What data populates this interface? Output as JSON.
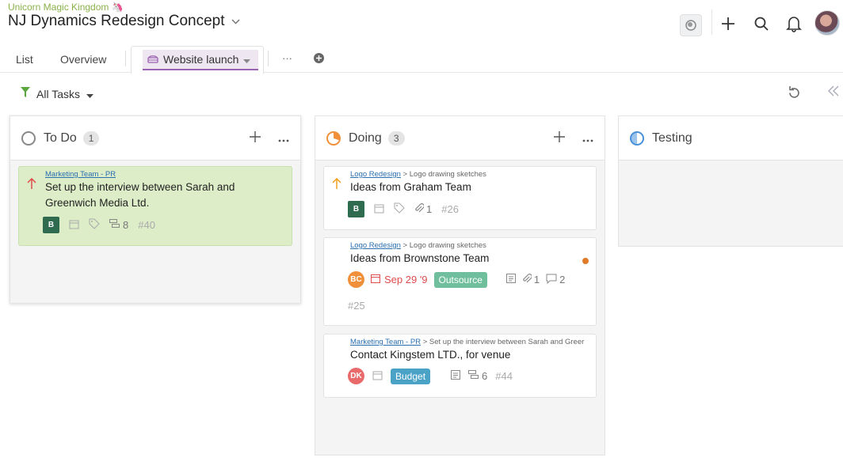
{
  "header": {
    "workspace": "Unicorn Magic Kingdom 🦄",
    "project_title": "NJ Dynamics Redesign Concept"
  },
  "tabs": {
    "list": "List",
    "overview": "Overview",
    "active": "Website launch",
    "more": "···"
  },
  "filter": {
    "label": "All Tasks"
  },
  "columns": {
    "todo": {
      "title": "To Do",
      "count": "1"
    },
    "doing": {
      "title": "Doing",
      "count": "3"
    },
    "testing": {
      "title": "Testing"
    }
  },
  "cards": {
    "c40": {
      "parent": "Marketing Team - PR",
      "title": "Set up the interview between Sarah and Greenwich Media Ltd.",
      "avatar": "B",
      "subtasks": "8",
      "id": "#40"
    },
    "c26": {
      "parent": "Logo Redesign",
      "trail": " > Logo drawing sketches",
      "title": "Ideas from Graham Team",
      "avatar": "B",
      "attachments": "1",
      "id": "#26"
    },
    "c25": {
      "parent": "Logo Redesign",
      "trail": " > Logo drawing sketches",
      "title": "Ideas from Brownstone Team",
      "avatar": "BC",
      "due": "Sep 29 '9",
      "tag": "Outsource",
      "attachments": "1",
      "comments": "2",
      "id": "#25"
    },
    "c44": {
      "parent": "Marketing Team - PR",
      "trail": " > Set up the interview between Sarah and Greer",
      "title": "Contact Kingstem LTD., for venue",
      "avatar": "DK",
      "tag": "Budget",
      "subtasks": "6",
      "id": "#44"
    }
  },
  "colors": {
    "accent": "#9b63b1",
    "todo_card": "#dcedc8",
    "doing_status": "#f0903a",
    "testing_status": "#4a90d9",
    "outsource_tag": "#6fbf9c",
    "budget_tag": "#4aa3c7",
    "due_date": "#e04b4b"
  },
  "icons": [
    "globe-icon",
    "plus-icon",
    "search-icon",
    "bell-icon",
    "filter-icon",
    "refresh-icon",
    "collapse-icon",
    "calendar-icon",
    "tag-icon",
    "subtask-icon",
    "attachment-icon",
    "comment-icon",
    "description-icon",
    "priority-up-icon"
  ]
}
